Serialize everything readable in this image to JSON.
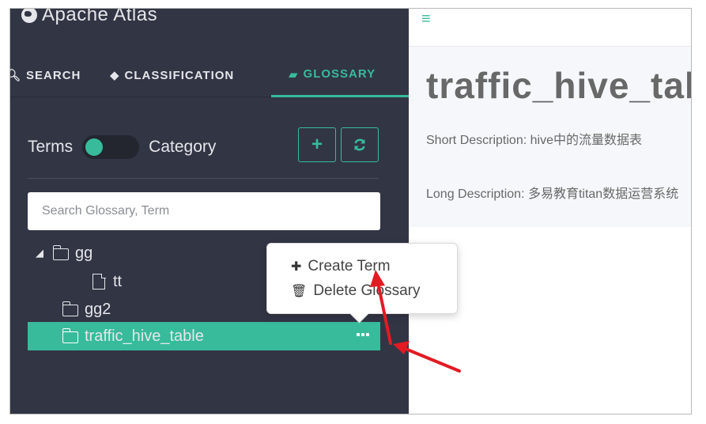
{
  "app": {
    "brand": "Apache Atlas",
    "brand_icon": "globe-icon"
  },
  "tabs": [
    {
      "label": "SEARCH",
      "icon": "search-icon"
    },
    {
      "label": "CLASSIFICATION",
      "icon": "tag-icon"
    },
    {
      "label": "GLOSSARY",
      "icon": "folder-open-icon",
      "active": true
    }
  ],
  "glossary_panel": {
    "toggle_left": "Terms",
    "toggle_right": "Category",
    "add_button": "+",
    "refresh_button": "refresh-icon",
    "search_placeholder": "Search Glossary, Term"
  },
  "tree": [
    {
      "label": "gg",
      "expanded": true,
      "children": [
        {
          "label": "tt"
        }
      ]
    },
    {
      "label": "gg2"
    },
    {
      "label": "traffic_hive_table",
      "selected": true
    }
  ],
  "context_menu": {
    "items": [
      {
        "label": "Create Term",
        "icon": "plus-icon"
      },
      {
        "label": "Delete Glossary",
        "icon": "trash-icon"
      }
    ]
  },
  "main": {
    "title": "traffic_hive_table",
    "short_description": "Short Description: hive中的流量数据表",
    "long_description": "Long Description: 多易教育titan数据运营系统"
  },
  "colors": {
    "accent": "#37bb9b",
    "sidebar_bg": "#323544",
    "annotation": "#e21b23"
  }
}
